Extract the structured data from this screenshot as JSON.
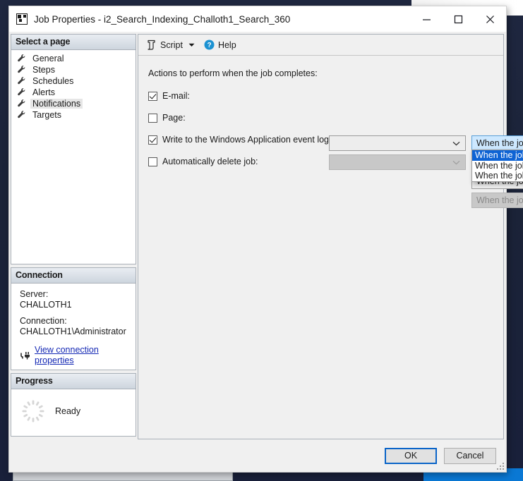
{
  "window": {
    "title": "Job Properties - i2_Search_Indexing_Challoth1_Search_360",
    "app_icon": "job-properties-icon",
    "minimize_label": "Minimize",
    "maximize_label": "Maximize",
    "close_label": "Close"
  },
  "sidebar": {
    "select_page": {
      "header": "Select a page",
      "items": [
        {
          "label": "General",
          "icon": "wrench-icon",
          "selected": false
        },
        {
          "label": "Steps",
          "icon": "wrench-icon",
          "selected": false
        },
        {
          "label": "Schedules",
          "icon": "wrench-icon",
          "selected": false
        },
        {
          "label": "Alerts",
          "icon": "wrench-icon",
          "selected": false
        },
        {
          "label": "Notifications",
          "icon": "wrench-icon",
          "selected": true
        },
        {
          "label": "Targets",
          "icon": "wrench-icon",
          "selected": false
        }
      ]
    },
    "connection": {
      "header": "Connection",
      "server_label": "Server:",
      "server_value": "CHALLOTH1",
      "connection_label": "Connection:",
      "connection_value": "CHALLOTH1\\Administrator",
      "link_text": "View connection properties",
      "link_icon": "plug-icon"
    },
    "progress": {
      "header": "Progress",
      "status": "Ready",
      "icon": "spinner-icon"
    }
  },
  "toolbar": {
    "script_label": "Script",
    "script_icon": "script-icon",
    "caret_icon": "chevron-down-icon",
    "help_label": "Help",
    "help_icon": "help-circle-icon"
  },
  "main": {
    "section_label": "Actions to perform when the job completes:",
    "rows": [
      {
        "label": "E-mail:",
        "checked": true,
        "operator_value": "",
        "operator_state": "enabled",
        "when_value": "When the job fails",
        "when_state": "focused"
      },
      {
        "label": "Page:",
        "checked": false,
        "operator_value": "",
        "operator_state": "disabled"
      },
      {
        "label": "Write to the Windows Application event log:",
        "checked": true,
        "when_value": "When the job fails",
        "when_state": "enabled"
      },
      {
        "label": "Automatically delete job:",
        "checked": false,
        "when_value": "When the job succeeds",
        "when_state": "disabled"
      }
    ],
    "dropdown": {
      "open": true,
      "options": [
        {
          "label": "When the job succeeds",
          "highlighted": true
        },
        {
          "label": "When the job fails",
          "highlighted": false
        },
        {
          "label": "When the job completes",
          "highlighted": false
        }
      ]
    }
  },
  "footer": {
    "ok_label": "OK",
    "cancel_label": "Cancel",
    "resize_grip": "resize-grip-icon"
  },
  "colors": {
    "accent": "#0e63d4",
    "focus_border": "#0a64c8",
    "link": "#1428b4",
    "desktop": "#1b2236"
  }
}
